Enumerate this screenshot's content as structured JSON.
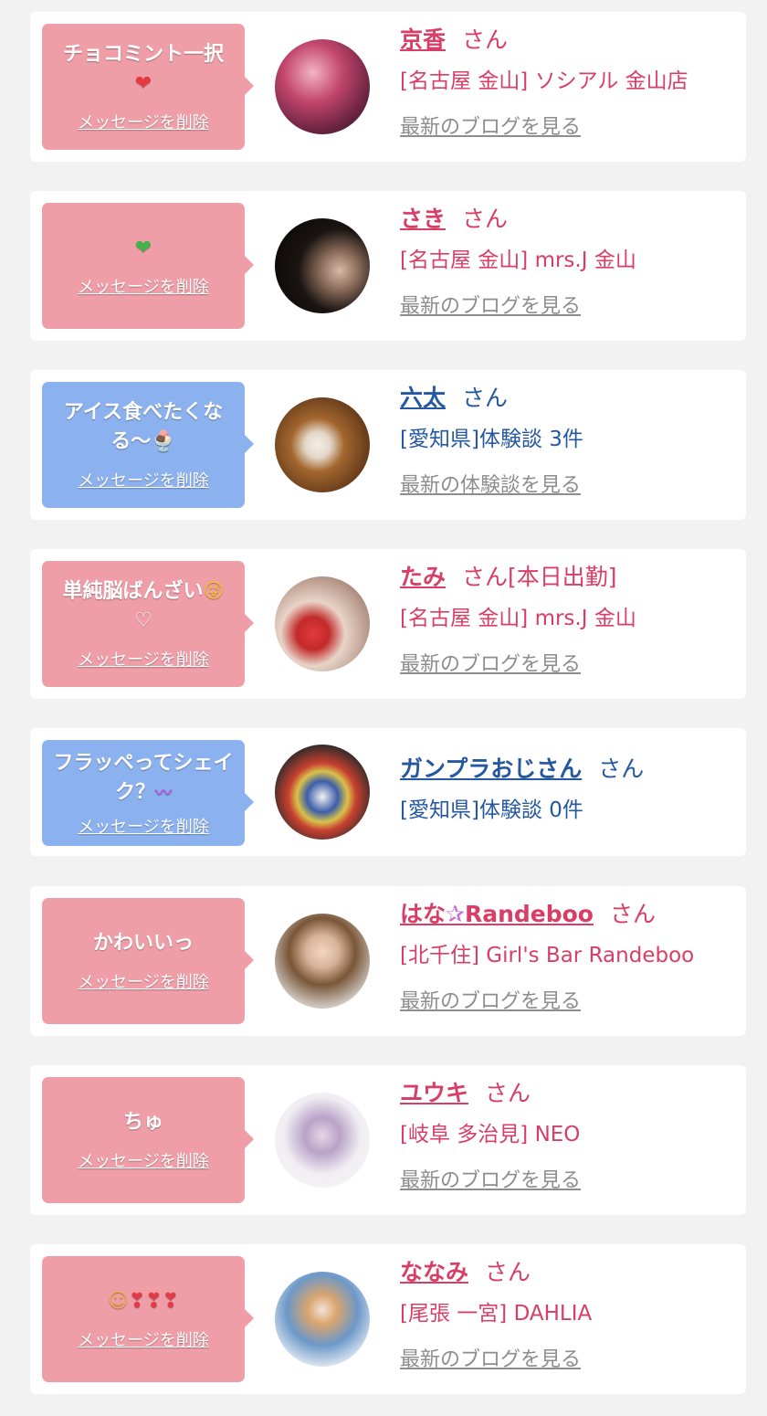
{
  "delete_label": "メッセージを削除",
  "san_label": "さん",
  "colors": {
    "pink_bubble": "#ef9ea8",
    "blue_bubble": "#8cb1ef",
    "pink_text": "#d83e66",
    "blue_text": "#2558a0",
    "link_gray": "#8d8d8d"
  },
  "cards": [
    {
      "message": "チョコミント一択",
      "message_icon": "red-heart",
      "name": "京香",
      "suffix": "",
      "shop": "[名古屋 金山] ソシアル 金山店",
      "link": "最新のブログを見る"
    },
    {
      "message": "",
      "message_icon": "green-heart",
      "name": "さき",
      "suffix": "",
      "shop": "[名古屋 金山] mrs.J 金山",
      "link": "最新のブログを見る"
    },
    {
      "message": "アイス食べたくなる〜",
      "message_icon": "ice-cream",
      "name": "六太",
      "suffix": "",
      "shop": "[愛知県]体験談 3件",
      "link": "最新の体験談を見る"
    },
    {
      "message": "単純脳ばんざい",
      "message_icon": "zany-face",
      "message_line2": "♡",
      "name": "たみ",
      "suffix": "[本日出勤]",
      "shop": "[名古屋 金山] mrs.J 金山",
      "link": "最新のブログを見る"
    },
    {
      "message": "フラッペってシェイク？",
      "message_icon": "squiggle",
      "name": "ガンプラおじさん",
      "suffix": "",
      "shop": "[愛知県]体験談 0件",
      "link": ""
    },
    {
      "message": "かわいいっ",
      "name_pre": "はな",
      "name_post": "Randeboo",
      "name_icon": "star-outline",
      "suffix": "",
      "shop": "[北千住] Girl's Bar Randeboo",
      "link": "最新のブログを見る"
    },
    {
      "message": "ちゅ",
      "name": "ユウキ",
      "suffix": "",
      "shop": "[岐阜 多治見] NEO",
      "link": "最新のブログを見る"
    },
    {
      "message": "",
      "message_icon": "smile-and-hearts",
      "name": "ななみ",
      "suffix": "",
      "shop": "[尾張 一宮] DAHLIA",
      "link": "最新のブログを見る"
    }
  ]
}
